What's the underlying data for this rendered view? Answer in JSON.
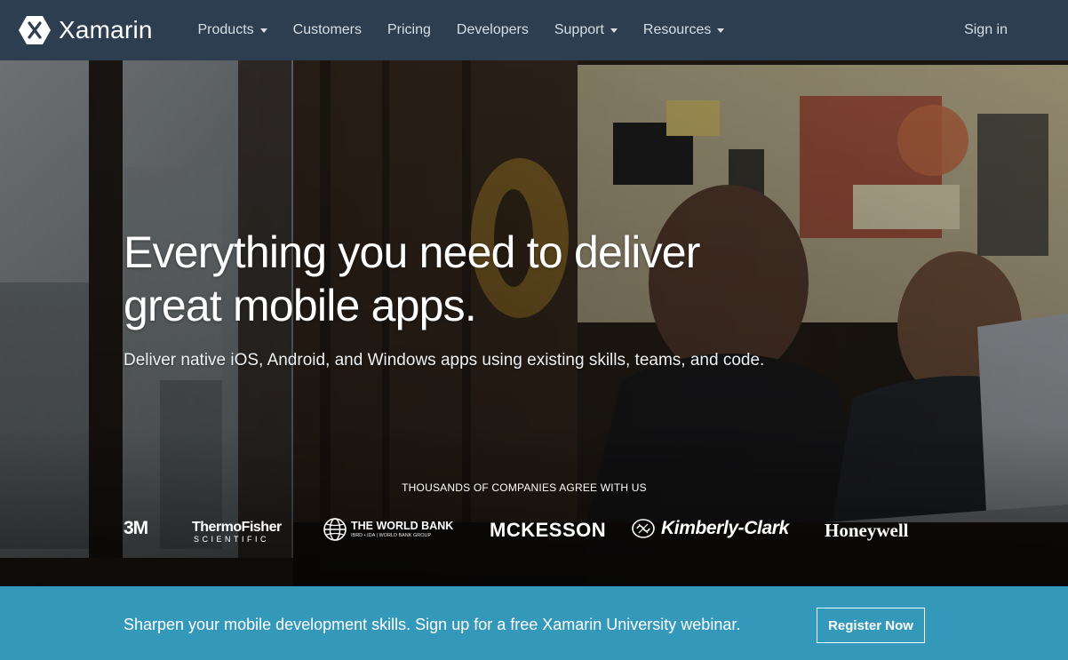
{
  "brand": {
    "name": "Xamarin"
  },
  "nav": {
    "items": [
      {
        "label": "Products",
        "dropdown": true
      },
      {
        "label": "Customers",
        "dropdown": false
      },
      {
        "label": "Pricing",
        "dropdown": false
      },
      {
        "label": "Developers",
        "dropdown": false
      },
      {
        "label": "Support",
        "dropdown": true
      },
      {
        "label": "Resources",
        "dropdown": true
      }
    ],
    "signin_label": "Sign in"
  },
  "hero": {
    "headline_line1": "Everything you need to deliver",
    "headline_line2": "great mobile apps.",
    "subhead": "Deliver native iOS, Android, and Windows apps using existing skills, teams, and code.",
    "companies_title": "THOUSANDS OF COMPANIES AGREE WITH US",
    "logos": {
      "threem": "3M",
      "thermo_line1": "ThermoFisher",
      "thermo_line2": "SCIENTIFIC",
      "worldbank_line1": "THE WORLD BANK",
      "worldbank_line2": "IBRD • IDA | WORLD BANK GROUP",
      "mckesson": "MCKESSON",
      "kimberly": "Kimberly-Clark",
      "honeywell": "Honeywell"
    }
  },
  "promo": {
    "text": "Sharpen your mobile development skills. Sign up for a free Xamarin University webinar.",
    "button_label": "Register Now"
  },
  "colors": {
    "navbar_bg": "#2c3e50",
    "promo_bg": "#3498bb",
    "text_white": "#ffffff",
    "nav_text": "#d8dee5"
  },
  "icons": {
    "brand": "xamarin-hexagon-x-icon",
    "dropdown": "caret-down-icon",
    "worldbank": "globe-icon",
    "kimberly": "kimberly-clark-emblem-icon"
  }
}
